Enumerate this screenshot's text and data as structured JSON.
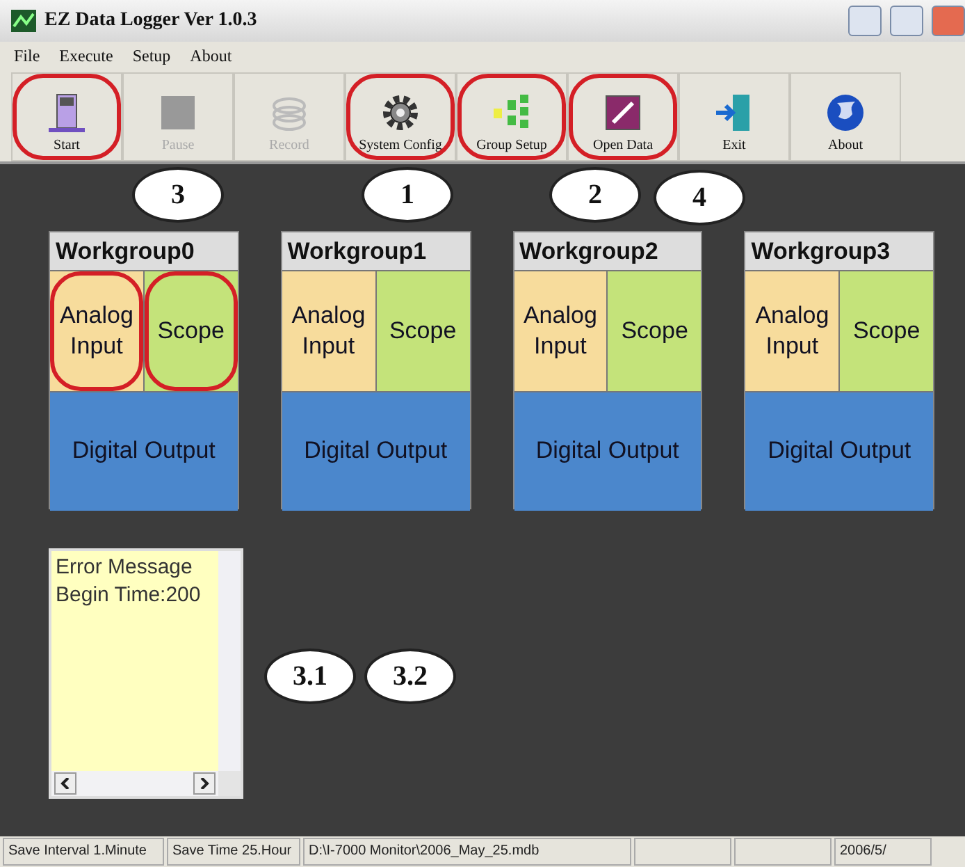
{
  "window": {
    "title": "EZ Data Logger Ver 1.0.3"
  },
  "menu": [
    "File",
    "Execute",
    "Setup",
    "About"
  ],
  "toolbar": [
    {
      "label": "Start",
      "kind": "start",
      "disabled": false,
      "highlighted": true
    },
    {
      "label": "Pause",
      "kind": "pause",
      "disabled": true,
      "highlighted": false
    },
    {
      "label": "Record",
      "kind": "record",
      "disabled": true,
      "highlighted": false
    },
    {
      "label": "System Config",
      "kind": "config",
      "disabled": false,
      "highlighted": true
    },
    {
      "label": "Group Setup",
      "kind": "group",
      "disabled": false,
      "highlighted": true
    },
    {
      "label": "Open Data",
      "kind": "open",
      "disabled": false,
      "highlighted": true
    },
    {
      "label": "Exit",
      "kind": "exit",
      "disabled": false,
      "highlighted": false
    },
    {
      "label": "About",
      "kind": "about",
      "disabled": false,
      "highlighted": false
    }
  ],
  "workgroups": [
    {
      "title": "Workgroup0",
      "cells": [
        {
          "label": "Analog Input",
          "kind": "analog",
          "highlighted": true
        },
        {
          "label": "Scope",
          "kind": "scope",
          "highlighted": true
        },
        {
          "label": "Digital Output",
          "kind": "digital",
          "highlighted": false
        }
      ]
    },
    {
      "title": "Workgroup1",
      "cells": [
        {
          "label": "Analog Input",
          "kind": "analog",
          "highlighted": false
        },
        {
          "label": "Scope",
          "kind": "scope",
          "highlighted": false
        },
        {
          "label": "Digital Output",
          "kind": "digital",
          "highlighted": false
        }
      ]
    },
    {
      "title": "Workgroup2",
      "cells": [
        {
          "label": "Analog Input",
          "kind": "analog",
          "highlighted": false
        },
        {
          "label": "Scope",
          "kind": "scope",
          "highlighted": false
        },
        {
          "label": "Digital Output",
          "kind": "digital",
          "highlighted": false
        }
      ]
    },
    {
      "title": "Workgroup3",
      "cells": [
        {
          "label": "Analog Input",
          "kind": "analog",
          "highlighted": false
        },
        {
          "label": "Scope",
          "kind": "scope",
          "highlighted": false
        },
        {
          "label": "Digital Output",
          "kind": "digital",
          "highlighted": false
        }
      ]
    }
  ],
  "error_log": {
    "lines": [
      "Error Message",
      "Begin Time:200"
    ]
  },
  "annotations": [
    {
      "label": "3"
    },
    {
      "label": "1"
    },
    {
      "label": "2"
    },
    {
      "label": "4"
    },
    {
      "label": "3.1"
    },
    {
      "label": "3.2"
    }
  ],
  "status_bar": [
    "Save Interval 1.Minute",
    "Save Time 25.Hour",
    "D:\\I-7000 Monitor\\2006_May_25.mdb",
    "2006/5/"
  ]
}
